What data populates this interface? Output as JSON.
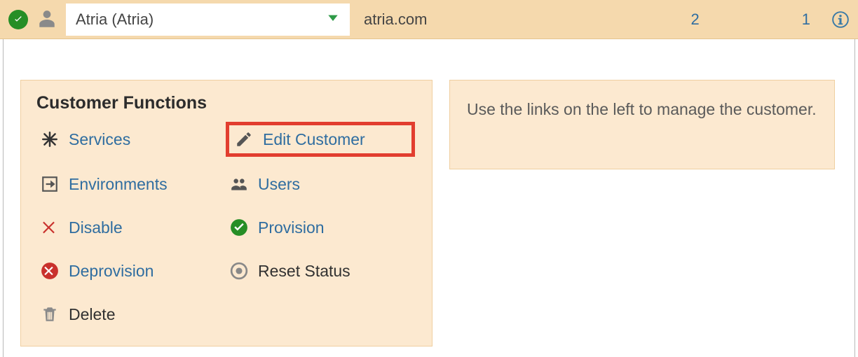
{
  "topbar": {
    "customerLabel": "Atria (Atria)",
    "domain": "atria.com",
    "countA": "2",
    "countB": "1"
  },
  "functions": {
    "title": "Customer Functions",
    "items": {
      "services": "Services",
      "edit": "Edit Customer",
      "environments": "Environments",
      "users": "Users",
      "disable": "Disable",
      "provision": "Provision",
      "deprovision": "Deprovision",
      "reset": "Reset Status",
      "delete": "Delete"
    }
  },
  "help": {
    "text": "Use the links on the left to manage the customer."
  }
}
